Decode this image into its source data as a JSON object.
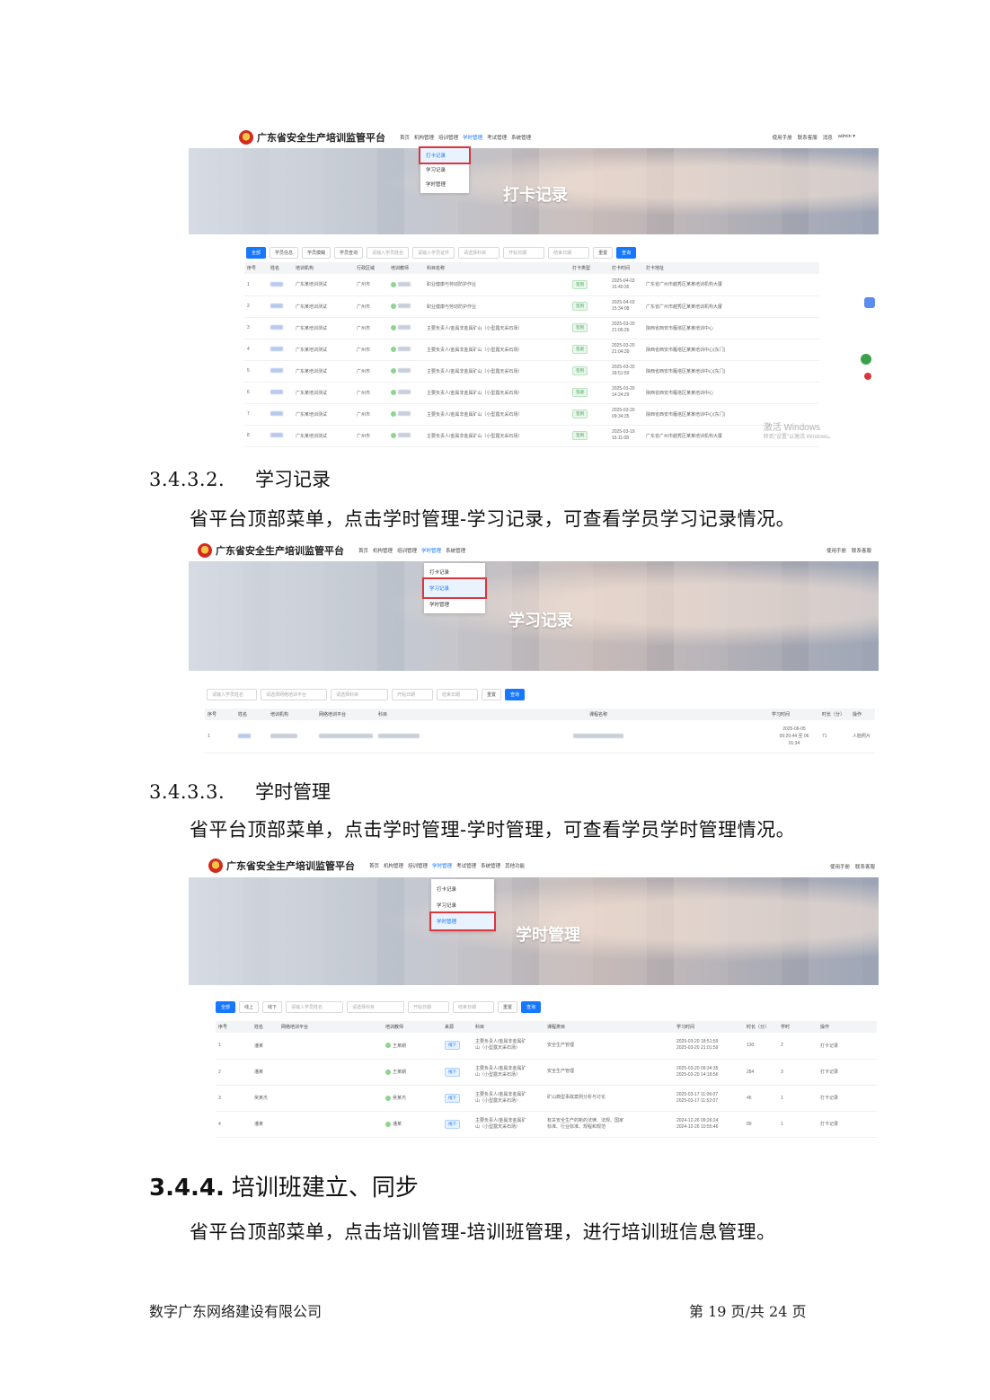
{
  "shot1": {
    "site_title": "广东省安全生产培训监管平台",
    "nav": [
      "首页",
      "机构管理",
      "培训管理",
      "学时管理",
      "考试管理",
      "系统管理"
    ],
    "right_links": [
      "使用手册",
      "联系客服",
      "消息",
      "admin ▾"
    ],
    "dropdown": [
      "打卡记录",
      "学习记录",
      "学时管理"
    ],
    "banner_title": "打卡记录",
    "filters": [
      "全部",
      "学员信息",
      "学员模糊",
      "学员查询",
      "请输入学员姓名",
      "请输入学员证件",
      "请选择科目",
      "开始日期",
      "结束日期",
      "重置",
      "查询"
    ],
    "columns": [
      "序号",
      "姓名",
      "培训机构",
      "行政区域",
      "培训教师",
      "科目名称",
      "打卡类型",
      "打卡时间",
      "打卡地址"
    ],
    "rows": [
      {
        "no": "1",
        "org": "广东某培训测试",
        "region": "广州市",
        "subject": "职业健康与劳动防护作业",
        "type": "签到",
        "time": "2025-04-03 15:40:35",
        "addr": "广东省广州市越秀区某某培训机构大厦"
      },
      {
        "no": "2",
        "org": "广东某培训测试",
        "region": "广州市",
        "subject": "职业健康与劳动防护作业",
        "type": "签到",
        "time": "2025-04-03 15:34:08",
        "addr": "广东省广州市越秀区某某培训机构大厦"
      },
      {
        "no": "3",
        "org": "广东某培训测试",
        "region": "广州市",
        "subject": "主要负责人/金属非金属矿山（小型露天采石场）",
        "type": "签到",
        "time": "2025-03-20 21:06:26",
        "addr": "陕西省西安市雁塔区某某培训中心"
      },
      {
        "no": "4",
        "org": "广东某培训测试",
        "region": "广州市",
        "subject": "主要负责人/金属非金属矿山（小型露天采石场）",
        "type": "签退",
        "time": "2025-03-20 21:04:39",
        "addr": "陕西省西安市雁塔区某某培训中心(东门)"
      },
      {
        "no": "5",
        "org": "广东某培训测试",
        "region": "广州市",
        "subject": "主要负责人/金属非金属矿山（小型露天采石场）",
        "type": "签到",
        "time": "2025-03-20 18:51:59",
        "addr": "陕西省西安市雁塔区某某培训中心(东门)"
      },
      {
        "no": "6",
        "org": "广东某培训测试",
        "region": "广州市",
        "subject": "主要负责人/金属非金属矿山（小型露天采石场）",
        "type": "签退",
        "time": "2025-03-20 14:24:29",
        "addr": "陕西省西安市雁塔区某某培训中心"
      },
      {
        "no": "7",
        "org": "广东某培训测试",
        "region": "广州市",
        "subject": "主要负责人/金属非金属矿山（小型露天采石场）",
        "type": "签到",
        "time": "2025-03-20 09:34:35",
        "addr": "陕西省西安市雁塔区某某培训中心(东门)"
      },
      {
        "no": "8",
        "org": "广东某培训测试",
        "region": "广州市",
        "subject": "主要负责人/金属非金属矿山（小型露天采石场）",
        "type": "签到",
        "time": "2025-03-19 16:11:08",
        "addr": "广东省广州市越秀区某某培训机构大厦"
      }
    ],
    "watermark_line1": "激活 Windows",
    "watermark_line2": "转到\"设置\"以激活 Windows。"
  },
  "heading_342": {
    "num": "3.4.3.2.",
    "title": "学习记录"
  },
  "para_342": "省平台顶部菜单，点击学时管理-学习记录，可查看学员学习记录情况。",
  "shot2": {
    "site_title": "广东省安全生产培训监管平台",
    "nav": [
      "首页",
      "机构管理",
      "培训管理",
      "学时管理",
      "系统管理"
    ],
    "right_links": [
      "使用手册",
      "联系客服"
    ],
    "dropdown": [
      "打卡记录",
      "学习记录",
      "学时管理"
    ],
    "banner_title": "学习记录",
    "filters": [
      "请输入学员姓名",
      "请选择网络培训平台",
      "请选择科目",
      "开始日期",
      "结束日期",
      "重置",
      "查询"
    ],
    "columns": [
      "序号",
      "姓名",
      "培训机构",
      "网络培训平台",
      "科目",
      "课程名称",
      "学习时间",
      "时长（分）",
      "操作"
    ],
    "row": {
      "no": "1",
      "time1": "2025-06-05",
      "time2": "00:20:44 至 06",
      "time3": "01:34",
      "duration": "71",
      "action": "人脸照片"
    }
  },
  "heading_343": {
    "num": "3.4.3.3.",
    "title": "学时管理"
  },
  "para_343": "省平台顶部菜单，点击学时管理-学时管理，可查看学员学时管理情况。",
  "shot3": {
    "site_title": "广东省安全生产培训监管平台",
    "nav": [
      "首页",
      "机构管理",
      "培训管理",
      "学时管理",
      "考试管理",
      "系统管理",
      "其他功能"
    ],
    "right_links": [
      "使用手册",
      "联系客服"
    ],
    "dropdown": [
      "打卡记录",
      "学习记录",
      "学时管理"
    ],
    "banner_title": "学时管理",
    "filters": [
      "全部",
      "线上",
      "线下",
      "请输入学员姓名",
      "请选择科目",
      "开始日期",
      "结束日期",
      "重置",
      "查询"
    ],
    "columns": [
      "序号",
      "姓名",
      "网络培训平台",
      "培训教师",
      "来源",
      "科目",
      "课程类目",
      "学习时间",
      "时长（分）",
      "学时",
      "操作"
    ],
    "rows": [
      {
        "no": "1",
        "name": "潘某",
        "teacher": "王某朗",
        "source": "线下",
        "subject1": "主要负责人/金属非金属矿",
        "subject2": "山（小型露天采石场）",
        "category1": "安全生产管理",
        "category2": "",
        "time1": "2025-03-20 18:51:59",
        "time2": "2025-03-20 21:01:59",
        "duration": "130",
        "hours": "2",
        "action": "打卡记录"
      },
      {
        "no": "2",
        "name": "潘某",
        "teacher": "王某朗",
        "source": "线下",
        "subject1": "主要负责人/金属非金属矿",
        "subject2": "山（小型露天采石场）",
        "category1": "安全生产管理",
        "category2": "",
        "time1": "2025-03-20 09:34:35",
        "time2": "2025-03-20 14:18:56",
        "duration": "284",
        "hours": "3",
        "action": "打卡记录"
      },
      {
        "no": "3",
        "name": "吴某杰",
        "teacher": "吴某杰",
        "source": "线下",
        "subject1": "主要负责人/金属非金属矿",
        "subject2": "山（小型露天采石场）",
        "category1": "矿山典型事故案例分析与讨论",
        "category2": "",
        "time1": "2025-03-17 11:06:07",
        "time2": "2025-03-17 11:52:07",
        "duration": "46",
        "hours": "1",
        "action": "打卡记录"
      },
      {
        "no": "4",
        "name": "潘某",
        "teacher": "潘某",
        "source": "线下",
        "subject1": "主要负责人/金属非金属矿",
        "subject2": "山（小型露天采石场）",
        "category1": "有关安全生产的新的法律、法规、国家",
        "category2": "标准、行业标准、规程和规范",
        "time1": "2024-12-26 09:26:24",
        "time2": "2024-12-26 10:55:46",
        "duration": "89",
        "hours": "1",
        "action": "打卡记录"
      }
    ]
  },
  "heading_344": {
    "num": "3.4.4.",
    "title": "培训班建立、同步"
  },
  "para_344": "省平台顶部菜单，点击培训管理-培训班管理，进行培训班信息管理。",
  "footer": {
    "company": "数字广东网络建设有限公司",
    "page": "第 19 页/共 24 页"
  }
}
